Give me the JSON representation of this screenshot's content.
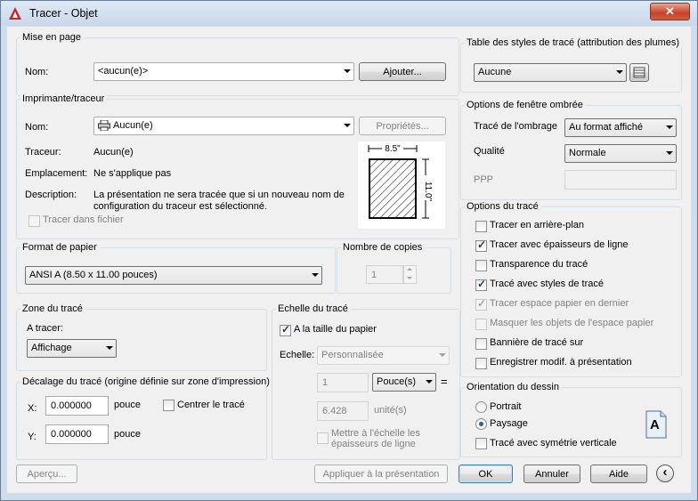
{
  "window": {
    "title": "Tracer - Objet",
    "close_label": "✕"
  },
  "page_setup": {
    "group_title": "Mise en page",
    "name_label": "Nom:",
    "name_value": "<aucun(e)>",
    "add_button": "Ajouter..."
  },
  "printer": {
    "group_title": "Imprimante/traceur",
    "name_label": "Nom:",
    "name_value": "Aucun(e)",
    "properties_button": "Propriétés...",
    "plotter_label": "Traceur:",
    "plotter_value": "Aucun(e)",
    "location_label": "Emplacement:",
    "location_value": "Ne s'applique pas",
    "description_label": "Description:",
    "description_line1": "La présentation ne sera tracée que si un nouveau nom de",
    "description_line2": "configuration du traceur est sélectionné.",
    "plot_to_file_label": "Tracer dans fichier",
    "plot_to_file_checked": false,
    "preview_width": "8.5\"",
    "preview_height": "11.0\""
  },
  "paper_size": {
    "group_title": "Format de papier",
    "value": "ANSI A (8.50 x 11.00 pouces)"
  },
  "copies": {
    "group_title": "Nombre de copies",
    "value": "1"
  },
  "plot_area": {
    "group_title": "Zone du tracé",
    "what_label": "A tracer:",
    "what_value": "Affichage"
  },
  "plot_offset": {
    "group_title": "Décalage du tracé (origine définie sur zone d'impression)",
    "x_label": "X:",
    "x_value": "0.000000",
    "x_unit": "pouce",
    "y_label": "Y:",
    "y_value": "0.000000",
    "y_unit": "pouce",
    "center_label": "Centrer le tracé",
    "center_checked": false
  },
  "plot_scale": {
    "group_title": "Echelle du tracé",
    "fit_label": "A la taille du papier",
    "fit_checked": true,
    "scale_label": "Echelle:",
    "scale_value": "Personnalisée",
    "value1": "1",
    "unit1": "Pouce(s)",
    "equals": "=",
    "value2": "6.428",
    "unit2": "unité(s)",
    "lineweights_label_line1": "Mettre à l'échelle les",
    "lineweights_label_line2": "épaisseurs de ligne",
    "lineweights_checked": false
  },
  "plot_style_table": {
    "group_title": "Table des styles de tracé (attribution des plumes)",
    "value": "Aucune"
  },
  "shaded_viewport": {
    "group_title": "Options de fenêtre ombrée",
    "shade_label": "Tracé de l'ombrage",
    "shade_value": "Au format affiché",
    "quality_label": "Qualité",
    "quality_value": "Normale",
    "dpi_label": "PPP",
    "dpi_value": ""
  },
  "plot_options": {
    "group_title": "Options du tracé",
    "items": [
      {
        "label": "Tracer en arrière-plan",
        "checked": false,
        "disabled": false
      },
      {
        "label": "Tracer avec épaisseurs de ligne",
        "checked": true,
        "disabled": false
      },
      {
        "label": "Transparence du tracé",
        "checked": false,
        "disabled": false
      },
      {
        "label": "Tracé avec styles de tracé",
        "checked": true,
        "disabled": false
      },
      {
        "label": "Tracer espace papier en dernier",
        "checked": true,
        "disabled": true
      },
      {
        "label": "Masquer les objets de l'espace papier",
        "checked": false,
        "disabled": true
      },
      {
        "label": "Bannière de tracé sur",
        "checked": false,
        "disabled": false
      },
      {
        "label": "Enregistrer modif. à présentation",
        "checked": false,
        "disabled": false
      }
    ]
  },
  "orientation": {
    "group_title": "Orientation du dessin",
    "portrait_label": "Portrait",
    "landscape_label": "Paysage",
    "selected": "Paysage",
    "upside_down_label": "Tracé avec symétrie verticale",
    "upside_down_checked": false,
    "icon_letter": "A"
  },
  "footer": {
    "preview_button": "Aperçu...",
    "apply_button": "Appliquer à la présentation",
    "ok_button": "OK",
    "cancel_button": "Annuler",
    "help_button": "Aide",
    "collapse_icon": "‹"
  }
}
